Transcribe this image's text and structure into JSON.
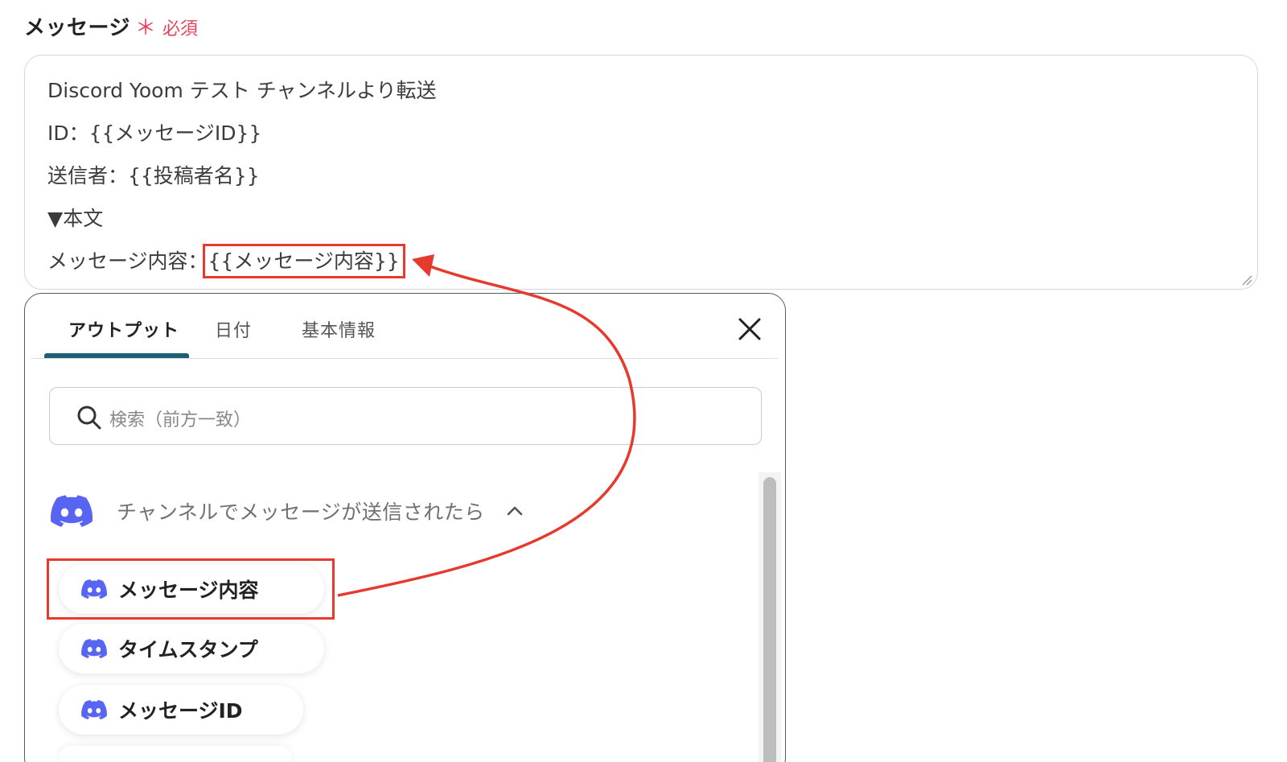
{
  "field": {
    "title": "メッセージ",
    "required_mark": "＊",
    "required_label": "必須"
  },
  "message_template": {
    "line1": "Discord Yoom テスト チャンネルより転送",
    "line2": "ID：{{メッセージID}}",
    "line3": "送信者：{{投稿者名}}",
    "line4": "▼本文",
    "line5_prefix": "メッセージ内容：",
    "line5_token": "{{メッセージ内容}}"
  },
  "output_panel": {
    "tabs": [
      "アウトプット",
      "日付",
      "基本情報"
    ],
    "active_tab": "アウトプット",
    "search_placeholder": "検索（前方一致）",
    "group_title": "チャンネルでメッセージが送信されたら",
    "items": [
      {
        "label": "メッセージ内容",
        "icon": "discord-icon",
        "highlighted": true
      },
      {
        "label": "タイムスタンプ",
        "icon": "discord-icon",
        "highlighted": false
      },
      {
        "label": "メッセージID",
        "icon": "discord-icon",
        "highlighted": false
      }
    ]
  },
  "colors": {
    "discord": "#5865F2",
    "highlight": "#E63A2E",
    "active_tab_underline": "#1C5F73",
    "required": "#E8425A"
  }
}
